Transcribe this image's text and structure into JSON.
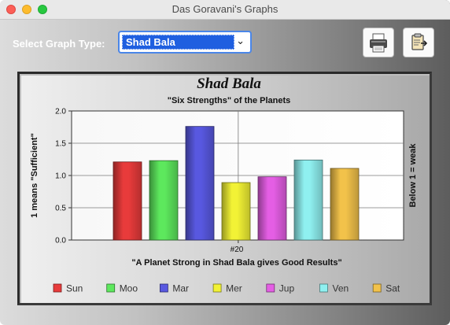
{
  "window": {
    "title": "Das Goravani's Graphs"
  },
  "toolbar": {
    "select_label": "Select Graph Type:",
    "graph_type": "Shad Bala",
    "print_icon": "printer-icon",
    "clipboard_icon": "clipboard-export-icon"
  },
  "chart_data": {
    "type": "bar",
    "title": "Shad Bala",
    "subtitle": "\"Six Strengths\" of the Planets",
    "xlabel": "\"A Planet Strong in Shad Bala gives Good Results\"",
    "ylabel": "1 means \"Sufficient\"",
    "ylabel_right": "Below 1 = weak",
    "x_tick_label": "#20",
    "ylim": [
      0,
      2.0
    ],
    "yticks": [
      "0.0",
      "0.5",
      "1.0",
      "1.5",
      "2.0"
    ],
    "grid": true,
    "legend_position": "bottom",
    "categories": [
      "Sun",
      "Moo",
      "Mar",
      "Mer",
      "Jup",
      "Ven",
      "Sat"
    ],
    "values": [
      1.21,
      1.23,
      1.76,
      0.89,
      0.98,
      1.24,
      1.11
    ],
    "colors": [
      "#e83b3b",
      "#5de85d",
      "#5858e0",
      "#f2f235",
      "#e45ee4",
      "#8ff0f0",
      "#f2c24a"
    ]
  }
}
